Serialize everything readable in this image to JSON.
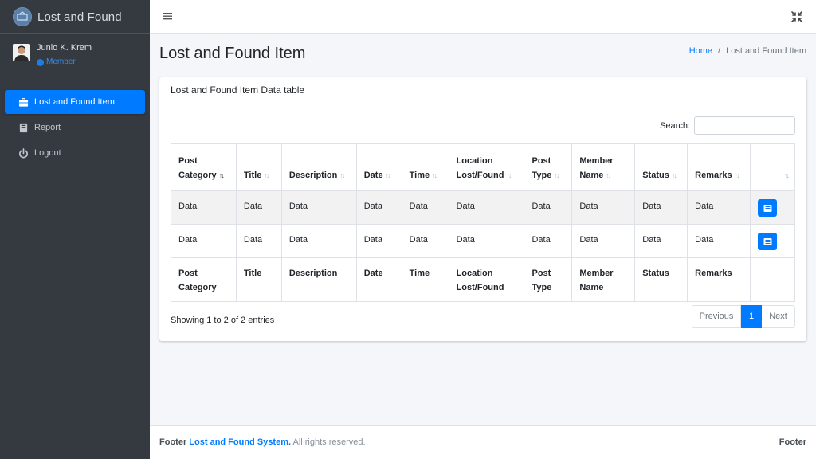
{
  "app": {
    "title": "Lost and Found"
  },
  "user": {
    "name": "Junio K. Krem",
    "role": "Member"
  },
  "sidebar": {
    "items": [
      {
        "label": "Lost and Found Item",
        "icon": "briefcase-icon",
        "active": true
      },
      {
        "label": "Report",
        "icon": "book-icon"
      },
      {
        "label": "Logout",
        "icon": "power-icon"
      }
    ]
  },
  "page": {
    "title": "Lost and Found Item",
    "breadcrumb": {
      "home": "Home",
      "separator": "/",
      "current": "Lost and Found Item"
    }
  },
  "card": {
    "title": "Lost and Found Item Data table",
    "search_label": "Search:",
    "search_value": ""
  },
  "table": {
    "headers": [
      [
        "Post",
        "Category"
      ],
      [
        "Title"
      ],
      [
        "Description"
      ],
      [
        "Date"
      ],
      [
        "Time"
      ],
      [
        "Location",
        "Lost/Found"
      ],
      [
        "Post",
        "Type"
      ],
      [
        "Member",
        "Name"
      ],
      [
        "Status"
      ],
      [
        "Remarks"
      ],
      [
        ""
      ]
    ],
    "rows": [
      [
        "Data",
        "Data",
        "Data",
        "Data",
        "Data",
        "Data",
        "Data",
        "Data",
        "Data",
        "Data"
      ],
      [
        "Data",
        "Data",
        "Data",
        "Data",
        "Data",
        "Data",
        "Data",
        "Data",
        "Data",
        "Data"
      ]
    ]
  },
  "info": "Showing 1 to 2 of 2 entries",
  "pagination": {
    "previous": "Previous",
    "current": "1",
    "next": "Next"
  },
  "footer": {
    "prefix": "Footer",
    "brand": "Lost and Found System.",
    "suffix": "All rights reserved.",
    "right": "Footer"
  },
  "colors": {
    "primary": "#007bff",
    "sidebar": "#343a40"
  }
}
